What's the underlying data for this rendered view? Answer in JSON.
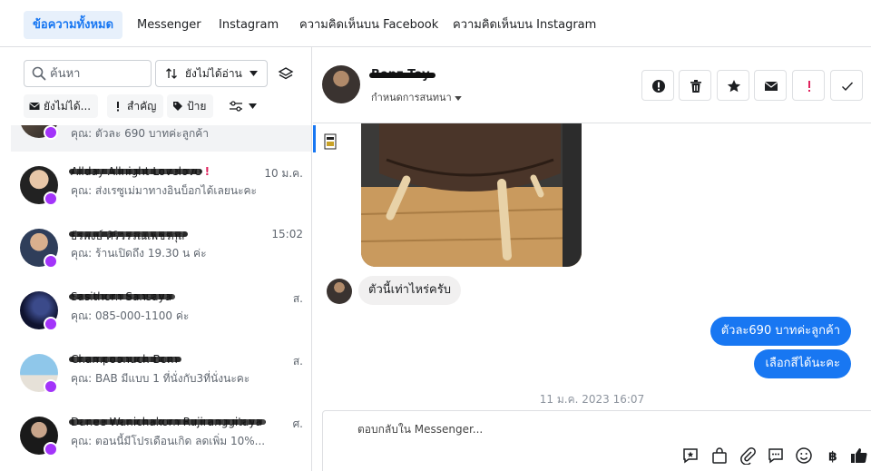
{
  "tabs": [
    {
      "label": "ข้อความทั้งหมด",
      "active": true
    },
    {
      "label": "Messenger",
      "active": false
    },
    {
      "label": "Instagram",
      "active": false
    },
    {
      "label": "ความคิดเห็นบน Facebook",
      "active": false
    },
    {
      "label": "ความคิดเห็นบน Instagram",
      "active": false
    }
  ],
  "search": {
    "placeholder": "ค้นหา"
  },
  "filter": {
    "label": "ยังไม่ได้อ่าน"
  },
  "chips": [
    {
      "label": "ยังไม่ได้...",
      "icon": "envelope-icon"
    },
    {
      "label": "สำคัญ",
      "icon": "exclamation-icon"
    },
    {
      "label": "ป้าย",
      "icon": "tag-icon"
    }
  ],
  "conversations": [
    {
      "name": "",
      "preview": "คุณ: ตัวละ 690 บาทค่ะลูกค้า",
      "time": ""
    },
    {
      "name": "Allday Allnight Lovelove",
      "preview": "คุณ: ส่งเรซูเม่มาทางอินบ็อกได้เลยนะคะ",
      "time": "10 ม.ค.",
      "flag": "!"
    },
    {
      "name": "ธีรพงษ์ ศิริวรรณเพชรกุล",
      "preview": "คุณ: ร้านเปิดถึง 19.30 น ค่ะ",
      "time": "15:02"
    },
    {
      "name": "Sasithorn Sansaya",
      "preview": "คุณ: 085-000-1100 ค่ะ",
      "time": "ส."
    },
    {
      "name": "Champoonuch Bom",
      "preview": "คุณ: BAB มีแบบ 1 ที่นั่งกับ3ที่นั่งนะคะ",
      "time": "ส."
    },
    {
      "name": "Danee Wanichakorn Rujiranggitaya",
      "preview": "คุณ: ตอนนี้มีโปรเดือนเกิด ลดเพิ่ม 10%...",
      "time": "ศ."
    }
  ],
  "header": {
    "name": "Benz Toy",
    "subtitle": "กำหนดการสนทนา"
  },
  "actions": [
    {
      "icon": "alert-circle-icon"
    },
    {
      "icon": "trash-icon"
    },
    {
      "icon": "star-icon"
    },
    {
      "icon": "envelope-icon"
    },
    {
      "icon": "exclamation-icon"
    },
    {
      "icon": "check-icon"
    }
  ],
  "messages": {
    "incoming": "ตัวนี้เท่าไหร่ครับ",
    "outgoing": [
      "ตัวละ690 บาทค่ะลูกค้า",
      "เลือกสีได้นะคะ"
    ],
    "timestamp": "11 ม.ค. 2023 16:07"
  },
  "composer": {
    "placeholder": "ตอบกลับใน Messenger..."
  },
  "colors": {
    "accent": "#1877f2",
    "messenger_badge": "#a334fa",
    "alert": "#e0245e"
  }
}
